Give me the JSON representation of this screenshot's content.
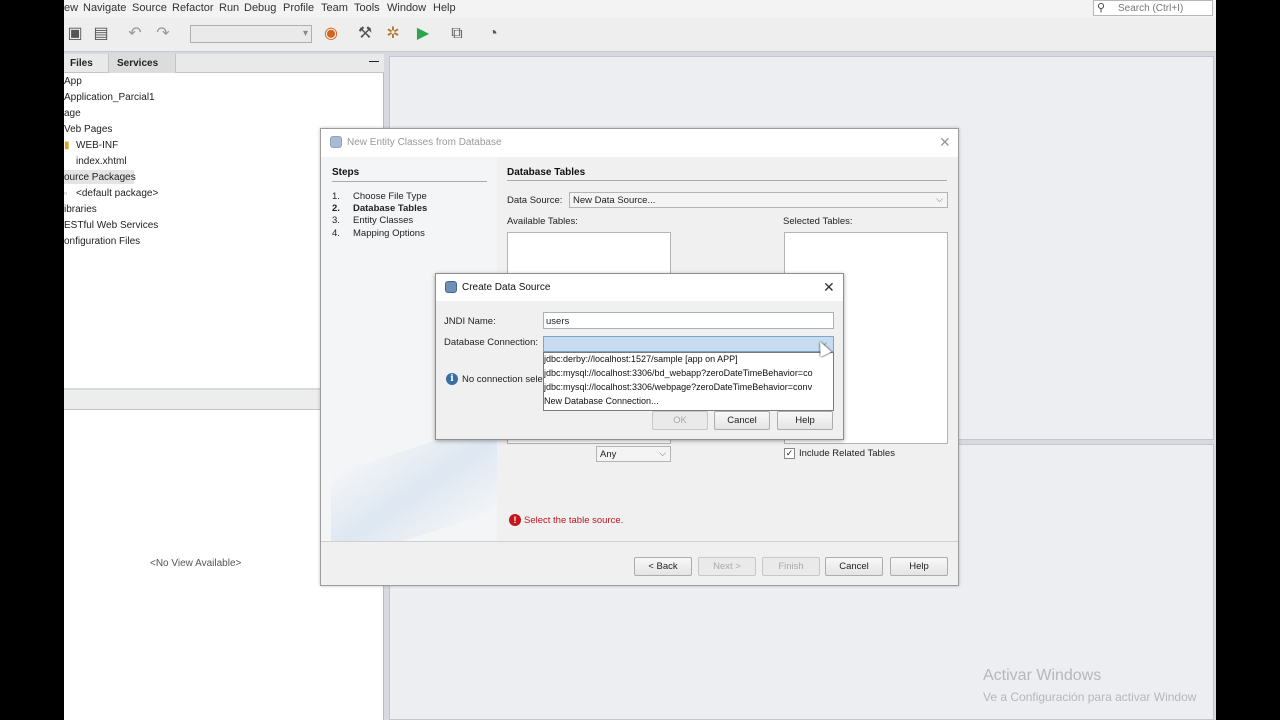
{
  "menubar": {
    "items": [
      "ew",
      "Navigate",
      "Source",
      "Refactor",
      "Run",
      "Debug",
      "Profile",
      "Team",
      "Tools",
      "Window",
      "Help"
    ],
    "search_placeholder": "Search (Ctrl+I)"
  },
  "project_panel": {
    "tabs": [
      "Files",
      "Services"
    ],
    "minimize": "—",
    "tree": [
      "App",
      "Application_Parcial1",
      "age",
      "Veb Pages",
      "WEB-INF",
      "index.xhtml",
      "ource Packages",
      "<default package>",
      "ibraries",
      "ESTful Web Services",
      "onfiguration Files"
    ]
  },
  "navigator": {
    "empty_text": "<No View Available>"
  },
  "wizard": {
    "title": "New Entity Classes from Database",
    "steps_title": "Steps",
    "steps": [
      {
        "num": "1.",
        "label": "Choose File Type"
      },
      {
        "num": "2.",
        "label": "Database Tables"
      },
      {
        "num": "3.",
        "label": "Entity Classes"
      },
      {
        "num": "4.",
        "label": "Mapping Options"
      }
    ],
    "section_title": "Database Tables",
    "data_source_label": "Data Source:",
    "data_source_value": "New Data Source...",
    "available_tables_label": "Available Tables:",
    "selected_tables_label": "Selected Tables:",
    "filter_value": "Any",
    "include_related_label": "Include Related Tables",
    "include_related_checked": "✓",
    "error_text": "Select the table source.",
    "buttons": {
      "back": "< Back",
      "next": "Next >",
      "finish": "Finish",
      "cancel": "Cancel",
      "help": "Help"
    }
  },
  "create_data_source": {
    "title": "Create Data Source",
    "jndi_label": "JNDI Name:",
    "jndi_value": "users",
    "db_conn_label": "Database Connection:",
    "info_text": "No connection sele",
    "options": [
      "jdbc:derby://localhost:1527/sample [app on APP]",
      "jdbc:mysql://localhost:3306/bd_webapp?zeroDateTimeBehavior=co",
      "jdbc:mysql://localhost:3306/webpage?zeroDateTimeBehavior=conv",
      "New Database Connection..."
    ],
    "buttons": {
      "ok": "OK",
      "cancel": "Cancel",
      "help": "Help"
    }
  },
  "watermark": {
    "line1": "Activar Windows",
    "line2": "Ve a Configuración para activar Window"
  },
  "colors": {
    "error": "#c4161c",
    "selection": "#c8dcf0"
  }
}
